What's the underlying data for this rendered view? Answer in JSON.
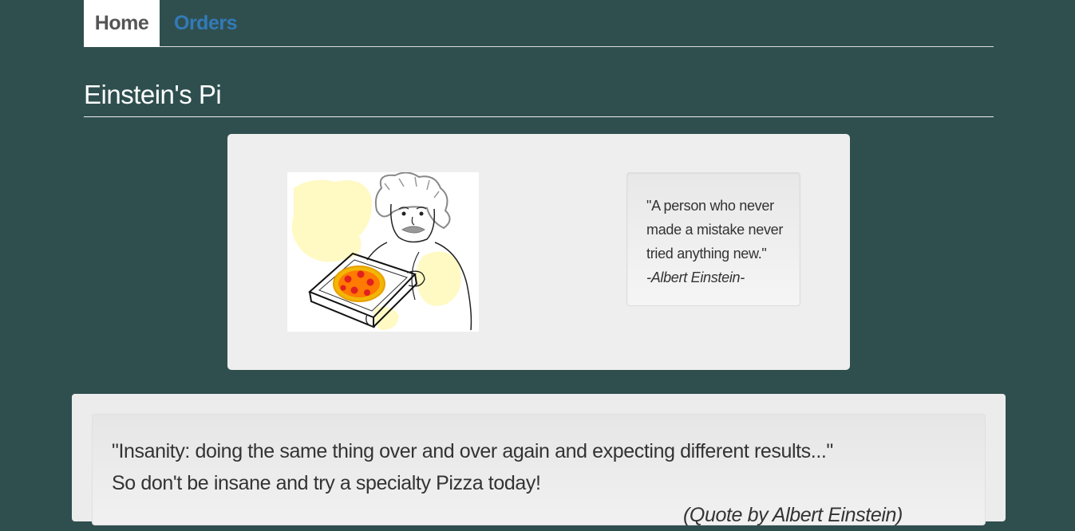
{
  "nav": {
    "tabs": [
      {
        "label": "Home",
        "active": true
      },
      {
        "label": "Orders",
        "active": false
      }
    ]
  },
  "page": {
    "title": "Einstein's Pi"
  },
  "hero": {
    "image_icon": "einstein-pizza-illustration",
    "quote_lines": [
      "\"A person who never",
      "made a mistake never",
      "tried anything new.\""
    ],
    "quote_author": "-Albert Einstein-"
  },
  "promo": {
    "line1": "\"Insanity: doing the same thing over and over again and expecting different results...\"",
    "line2": "So don't be insane and try a specialty Pizza today!",
    "credit": "(Quote by Albert Einstein)"
  },
  "colors": {
    "background": "#2f4f4f",
    "link": "#337ab7",
    "panel": "#eeeeee"
  }
}
